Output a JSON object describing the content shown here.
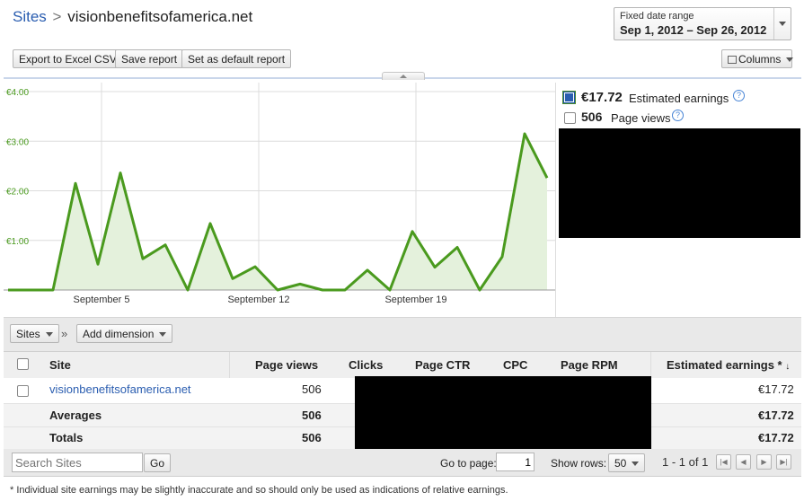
{
  "breadcrumb": {
    "root": "Sites",
    "separator": ">",
    "current": "visionbenefitsofamerica.net"
  },
  "date_range": {
    "label": "Fixed date range",
    "value": "Sep 1, 2012 – Sep 26, 2012"
  },
  "toolbar": {
    "export_label": "Export to Excel CSV",
    "save_label": "Save report",
    "default_label": "Set as default report",
    "columns_label": "Columns"
  },
  "legend": {
    "earnings": {
      "value": "€17.72",
      "label": "Estimated earnings",
      "checked": true
    },
    "pageviews": {
      "value": "506",
      "label": "Page views",
      "checked": false
    }
  },
  "chart_data": {
    "type": "area",
    "y_tick_labels": [
      "€4.00",
      "€3.00",
      "€2.00",
      "€1.00"
    ],
    "x_tick_labels": [
      "September 5",
      "September 12",
      "September 19"
    ],
    "ylim": [
      0,
      4
    ],
    "x": [
      1,
      2,
      3,
      4,
      5,
      6,
      7,
      8,
      9,
      10,
      11,
      12,
      13,
      14,
      15,
      16,
      17,
      18,
      19,
      20,
      21,
      22,
      23,
      24,
      25,
      26
    ],
    "series": [
      {
        "name": "Estimated earnings",
        "values": [
          0,
          0,
          0,
          2.15,
          0.52,
          2.36,
          0.63,
          0.91,
          0,
          1.34,
          0.23,
          0.47,
          0,
          0.12,
          0,
          0,
          0.4,
          0,
          1.18,
          0.46,
          0.86,
          0,
          0.67,
          3.15,
          2.26
        ]
      }
    ],
    "color": "#4a9a1e",
    "fill": "#e4f1dc",
    "grid": true
  },
  "dimension": {
    "sites_label": "Sites",
    "sep": "»",
    "add_label": "Add dimension"
  },
  "table": {
    "headers": {
      "site": "Site",
      "pageviews": "Page views",
      "clicks": "Clicks",
      "ctr": "Page CTR",
      "cpc": "CPC",
      "rpm": "Page RPM",
      "earnings": "Estimated earnings *"
    },
    "rows": [
      {
        "site": "visionbenefitsofamerica.net",
        "pageviews": "506",
        "earnings": "€17.72"
      }
    ],
    "averages": {
      "label": "Averages",
      "pageviews": "506",
      "earnings": "€17.72"
    },
    "totals": {
      "label": "Totals",
      "pageviews": "506",
      "earnings": "€17.72"
    }
  },
  "footer": {
    "search_placeholder": "Search Sites",
    "go_label": "Go",
    "goto_label": "Go to page:",
    "goto_value": "1",
    "rows_label": "Show rows:",
    "rows_value": "50",
    "range": "1 - 1 of 1"
  },
  "note": "* Individual site earnings may be slightly inaccurate and so should only be used as indications of relative earnings."
}
